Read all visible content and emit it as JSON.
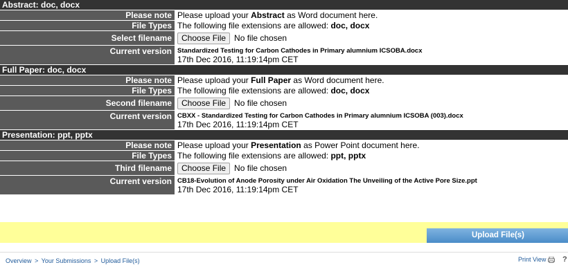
{
  "sections": [
    {
      "title": "Abstract: doc, docx",
      "note_label": "Please note",
      "note_pre": "Please upload your ",
      "note_strong": "Abstract",
      "note_post": " as Word document here.",
      "types_label": "File Types",
      "types_pre": "The following file extensions are allowed: ",
      "types_strong": "doc, docx",
      "file_label": "Select filename",
      "choose_label": "Choose File",
      "no_file": "No file chosen",
      "current_label": "Current version",
      "current_name": "Standardized Testing for Carbon Cathodes in Primary alumnium ICSOBA.docx",
      "current_date": "17th Dec 2016, 11:19:14pm CET"
    },
    {
      "title": "Full Paper: doc, docx",
      "note_label": "Please note",
      "note_pre": "Please upload your ",
      "note_strong": "Full Paper",
      "note_post": " as Word document here.",
      "types_label": "File Types",
      "types_pre": "The following file extensions are allowed: ",
      "types_strong": "doc, docx",
      "file_label": "Second filename",
      "choose_label": "Choose File",
      "no_file": "No file chosen",
      "current_label": "Current version",
      "current_name": "CBXX - Standardized Testing for Carbon Cathodes in Primary alumnium ICSOBA (003).docx",
      "current_date": "17th Dec 2016, 11:19:14pm CET"
    },
    {
      "title": "Presentation: ppt, pptx",
      "note_label": "Please note",
      "note_pre": "Please upload your ",
      "note_strong": "Presentation",
      "note_post": " as Power Point document here.",
      "types_label": "File Types",
      "types_pre": "The following file extensions are allowed: ",
      "types_strong": "ppt, pptx",
      "file_label": "Third filename",
      "choose_label": "Choose File",
      "no_file": "No file chosen",
      "current_label": "Current version",
      "current_name": "CB18-Evolution of Anode Porosity under Air Oxidation The Unveiling of the Active Pore Size.ppt",
      "current_date": "17th Dec 2016, 11:19:14pm CET"
    }
  ],
  "upload_label": "Upload File(s)",
  "breadcrumb": [
    "Overview",
    "Your Submissions",
    "Upload File(s)"
  ],
  "breadcrumb_sep": ">",
  "print_view": "Print View",
  "icons": {
    "print": "printer-icon",
    "help": "help-icon"
  },
  "help_glyph": "?",
  "colors": {
    "header": "#333333",
    "label": "#5a5a5a",
    "highlight": "#ffff99",
    "button": "#4a8cc8",
    "link": "#1f5a9a"
  }
}
